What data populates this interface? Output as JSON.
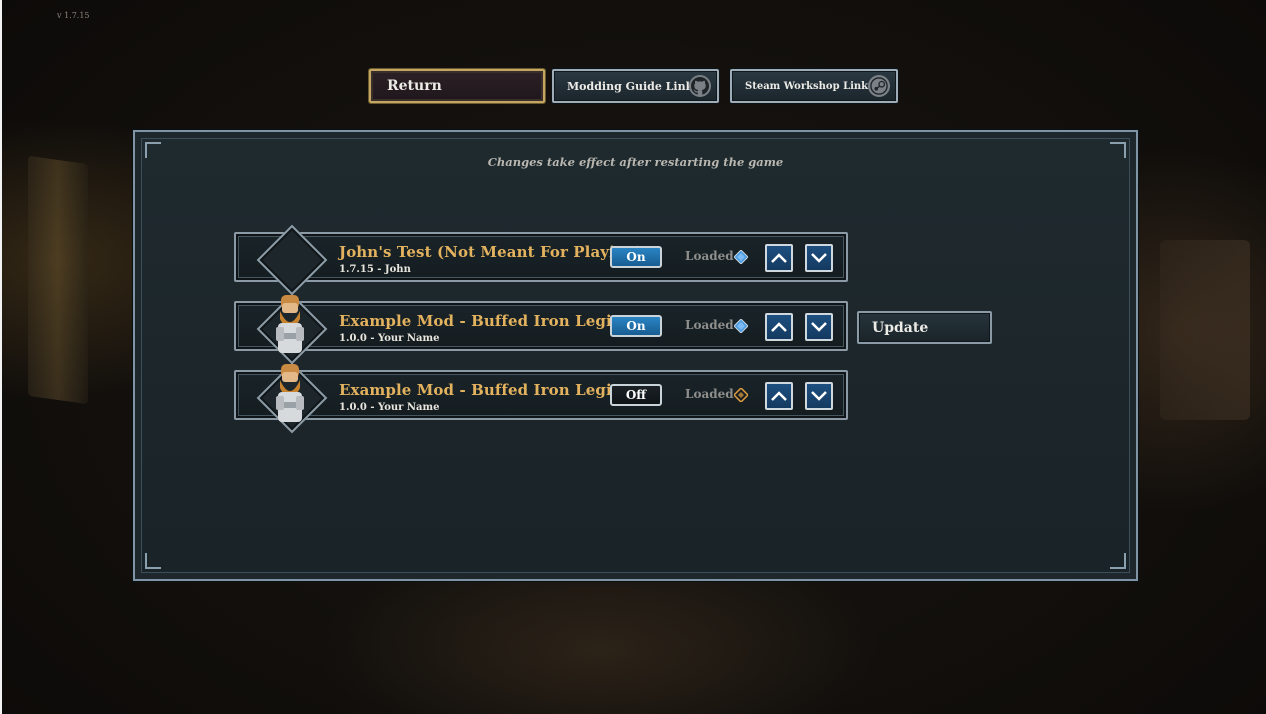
{
  "version": "v 1.7.15",
  "top_buttons": {
    "return_label": "Return",
    "guide_label": "Modding Guide Link",
    "guide_icon": "github-icon",
    "steam_label": "Steam Workshop Link",
    "steam_icon": "steam-icon"
  },
  "panel": {
    "notice": "Changes take effect after restarting the game"
  },
  "mods": [
    {
      "title": "John's Test (Not Meant For Playing)",
      "meta": "1.7.15 - John",
      "toggle": "On",
      "status": "Loaded",
      "gem_color": "#4a9be0",
      "has_avatar": false
    },
    {
      "title": "Example Mod - Buffed Iron Legion",
      "meta": "1.0.0 - Your Name",
      "toggle": "On",
      "status": "Loaded",
      "gem_color": "#4a9be0",
      "has_avatar": true
    },
    {
      "title": "Example Mod - Buffed Iron Legion",
      "meta": "1.0.0 - Your Name",
      "toggle": "Off",
      "status": "Loaded",
      "gem_color": "#e0a040",
      "has_avatar": true
    }
  ],
  "update_label": "Update",
  "colors": {
    "title_gold": "#e3b25e",
    "toggle_on": "#2a84c3",
    "arrow_blue": "#1d4f80"
  }
}
